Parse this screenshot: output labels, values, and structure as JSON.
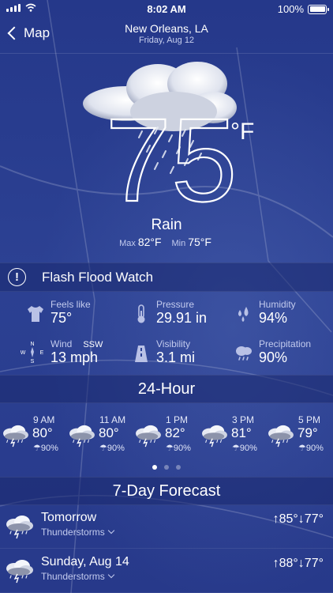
{
  "status_bar": {
    "time": "8:02 AM",
    "battery": "100%"
  },
  "nav": {
    "back_label": "Map",
    "city": "New Orleans, LA",
    "date": "Friday, Aug 12"
  },
  "current": {
    "icon": "rain-cloud-icon",
    "temperature": "75",
    "unit": "°F",
    "condition": "Rain",
    "max_label": "Max",
    "max_value": "82°F",
    "min_label": "Min",
    "min_value": "75°F"
  },
  "alert": {
    "icon": "exclamation-icon",
    "text": "Flash Flood Watch"
  },
  "details": {
    "feels_like": {
      "label": "Feels like",
      "value": "75°",
      "icon": "shirt-icon"
    },
    "pressure": {
      "label": "Pressure",
      "value": "29.91 in",
      "icon": "thermometer-icon"
    },
    "humidity": {
      "label": "Humidity",
      "value": "94%",
      "icon": "droplets-icon"
    },
    "wind": {
      "label": "Wind",
      "direction": "SSW",
      "value": "13 mph",
      "icon": "compass-icon"
    },
    "visibility": {
      "label": "Visibility",
      "value": "3.1 mi",
      "icon": "road-icon"
    },
    "precipitation": {
      "label": "Precipitation",
      "value": "90%",
      "icon": "rain-cloud-small-icon"
    }
  },
  "hourly": {
    "title": "24-Hour",
    "items": [
      {
        "time": "9 AM",
        "temp": "80°",
        "precip": "90%",
        "icon": "thunderstorm-icon"
      },
      {
        "time": "11 AM",
        "temp": "80°",
        "precip": "90%",
        "icon": "thunderstorm-icon"
      },
      {
        "time": "1 PM",
        "temp": "82°",
        "precip": "90%",
        "icon": "thunderstorm-icon"
      },
      {
        "time": "3 PM",
        "temp": "81°",
        "precip": "90%",
        "icon": "thunderstorm-icon"
      },
      {
        "time": "5 PM",
        "temp": "79°",
        "precip": "90%",
        "icon": "thunderstorm-icon"
      }
    ],
    "page_count": 3,
    "active_page": 1
  },
  "forecast": {
    "title": "7-Day Forecast",
    "days": [
      {
        "name": "Tomorrow",
        "summary": "Thunderstorms",
        "high": "↑85°",
        "low": "↓77°",
        "icon": "thunderstorm-icon"
      },
      {
        "name": "Sunday, Aug 14",
        "summary": "Thunderstorms",
        "high": "↑88°",
        "low": "↓77°",
        "icon": "thunderstorm-icon"
      }
    ]
  },
  "colors": {
    "background": "#263a86",
    "section_band": "#1c2a6e",
    "text": "#ffffff"
  }
}
